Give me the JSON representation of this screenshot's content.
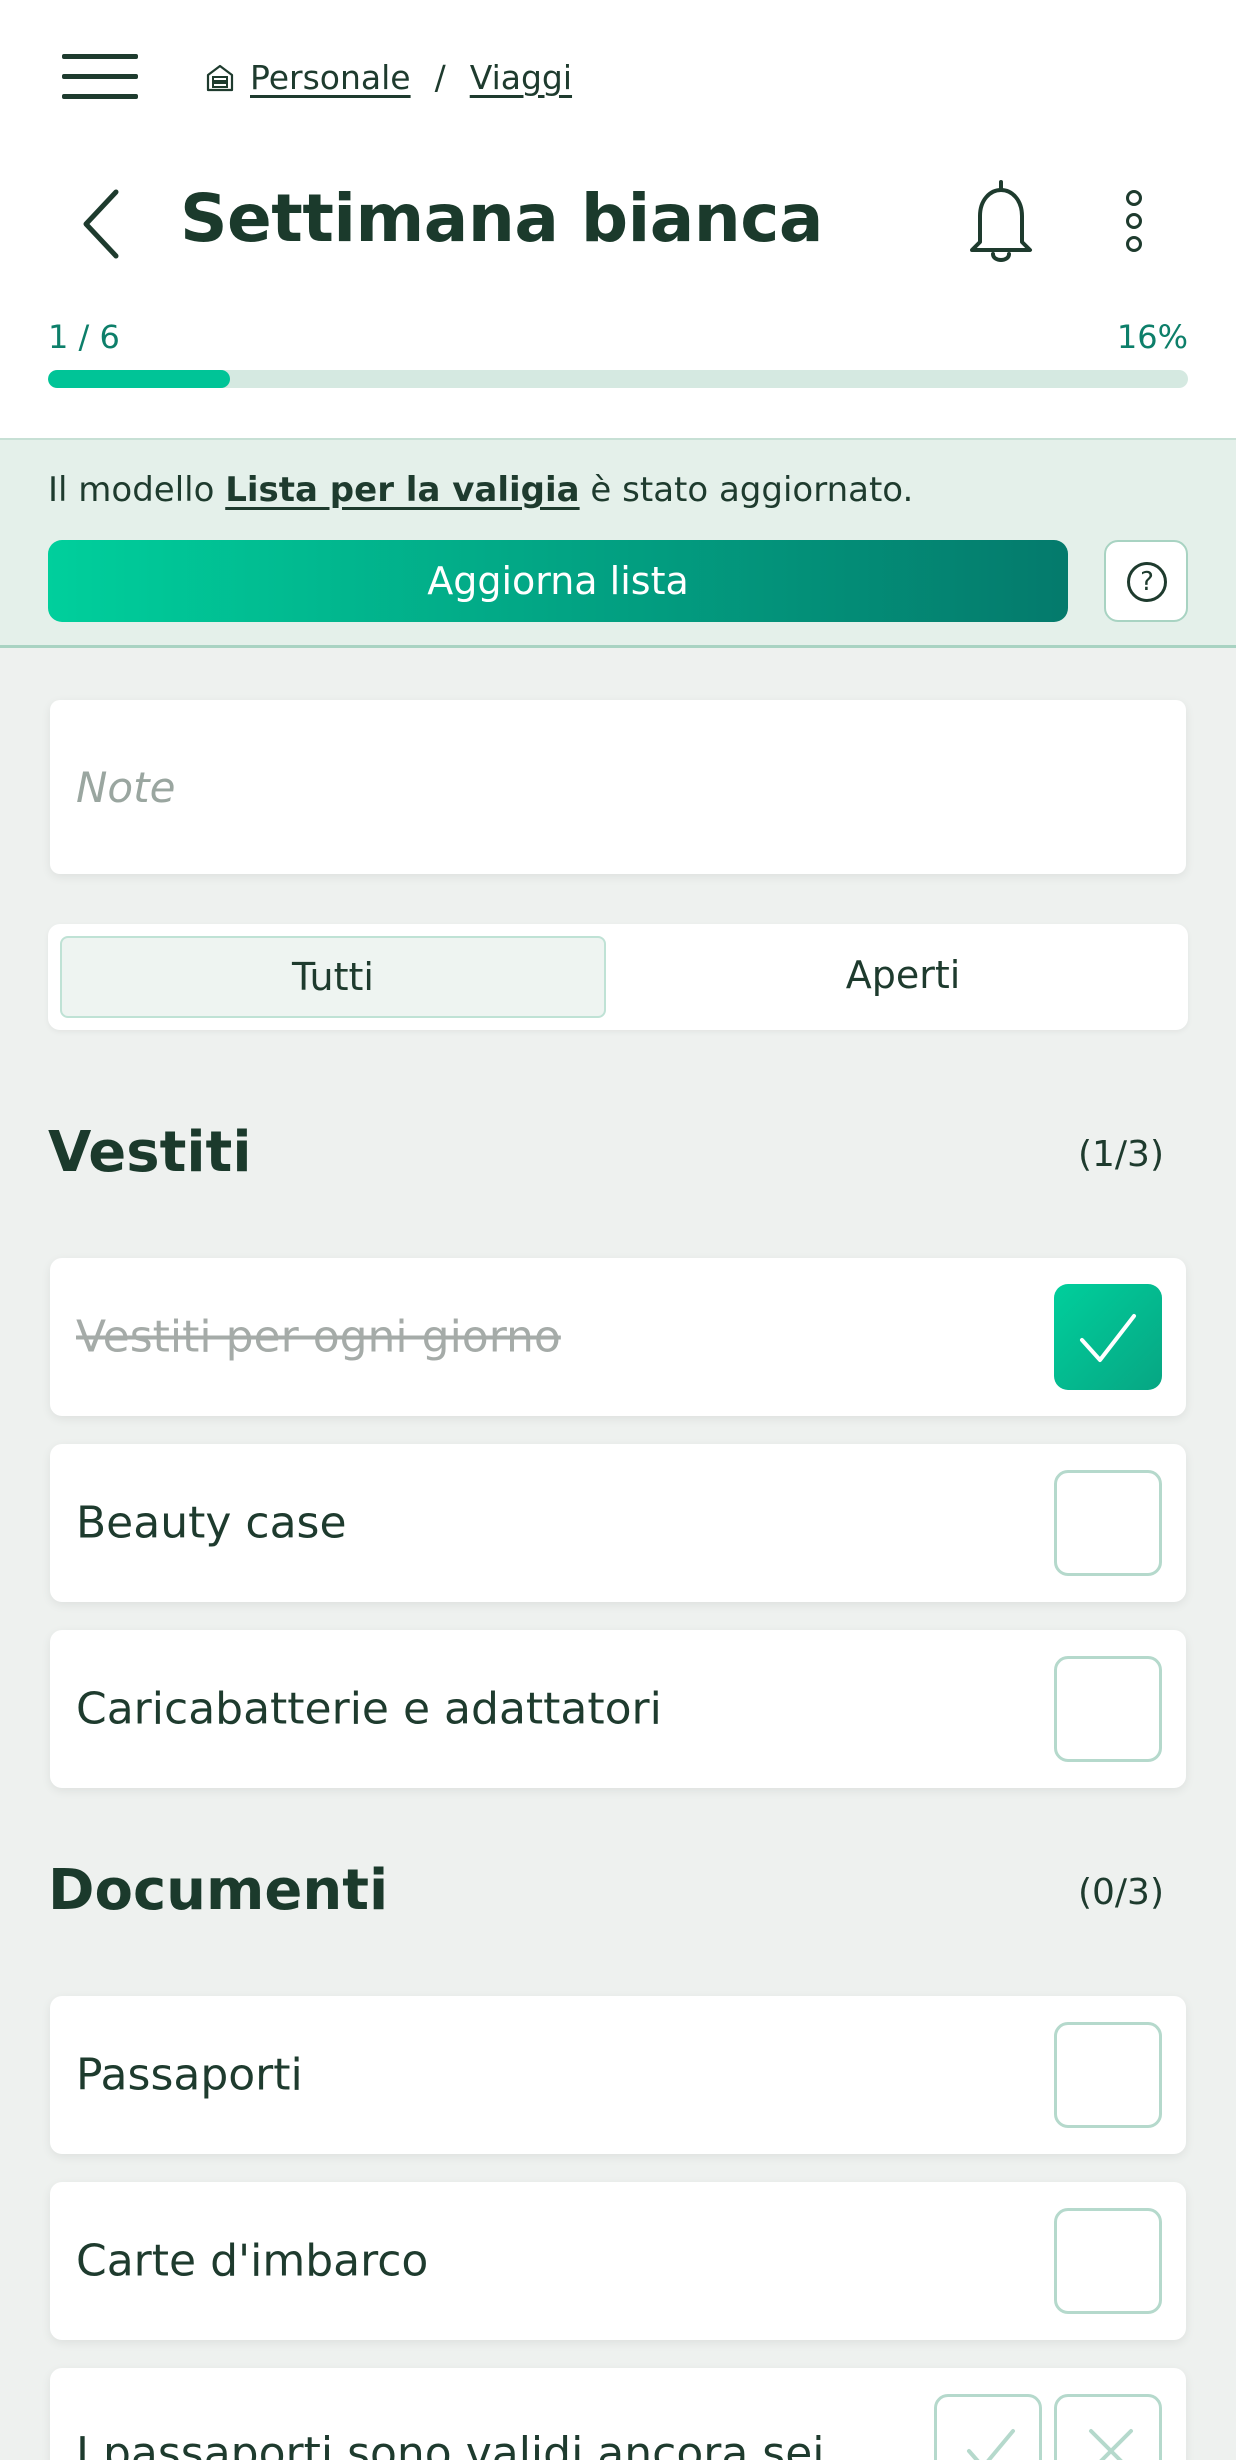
{
  "breadcrumb": {
    "home_icon": "home-icon",
    "items": [
      "Personale",
      "Viaggi"
    ],
    "separator": "/"
  },
  "header": {
    "title": "Settimana bianca"
  },
  "progress": {
    "count_text": "1 / 6",
    "percent_text": "16%",
    "fraction": 0.16
  },
  "banner": {
    "prefix": "Il modello ",
    "template_name": "Lista per la valigia",
    "suffix": " è stato aggiornato.",
    "update_button": "Aggiorna lista",
    "help_symbol": "?"
  },
  "note": {
    "placeholder": "Note",
    "value": ""
  },
  "filter": {
    "all": "Tutti",
    "open": "Aperti",
    "selected": "Tutti"
  },
  "sections": [
    {
      "title": "Vestiti",
      "count": "(1/3)",
      "items": [
        {
          "label": "Vestiti per ogni giorno",
          "checked": true
        },
        {
          "label": "Beauty case",
          "checked": false
        },
        {
          "label": "Caricabatterie e adattatori",
          "checked": false
        }
      ]
    },
    {
      "title": "Documenti",
      "count": "(0/3)",
      "items": [
        {
          "label": "Passaporti",
          "checked": false
        },
        {
          "label": "Carte d'imbarco",
          "checked": false
        },
        {
          "label": "I passaporti sono validi ancora sei",
          "checked": false
        }
      ]
    }
  ],
  "colors": {
    "accent": "#00c497",
    "accent_dark": "#047a6c",
    "text": "#1e3b2e",
    "banner_bg": "#e4f0ea",
    "page_bg": "#eef1ef"
  }
}
